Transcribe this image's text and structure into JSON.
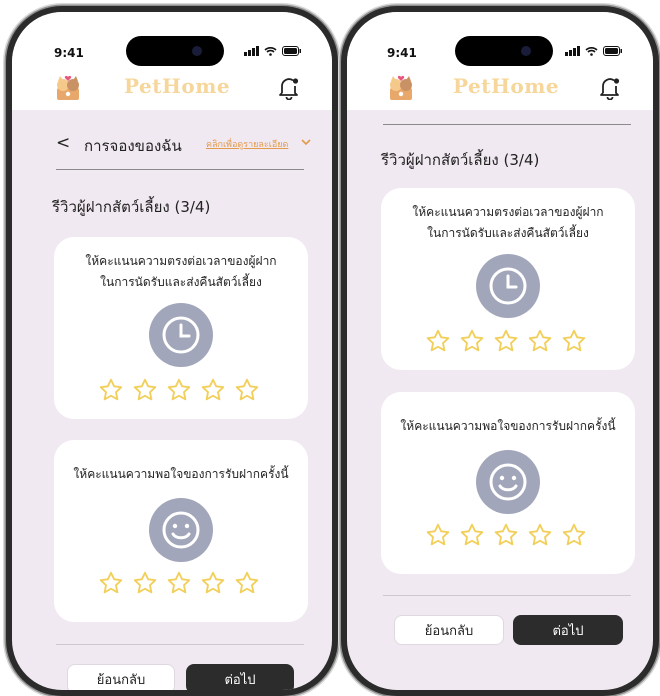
{
  "status": {
    "time": "9:41"
  },
  "brand": {
    "name": "PetHome"
  },
  "header": {
    "back_symbol": "<",
    "title": "การจองของฉัน",
    "details_link": "คลิกเพื่อดูรายละเอียด"
  },
  "section": {
    "title": "รีวิวผู้ฝากสัตว์เลี้ยง (3/4)"
  },
  "questions": [
    {
      "line1": "ให้คะแนนความตรงต่อเวลาของผู้ฝาก",
      "line2": "ในการนัดรับและส่งคืนสัตว์เลี้ยง",
      "icon": "clock-icon",
      "rating": 0,
      "max": 5
    },
    {
      "line1": "ให้คะแนนความพอใจของการรับฝากครั้งนี้",
      "line2": "",
      "icon": "smiley-icon",
      "rating": 0,
      "max": 5
    }
  ],
  "buttons": {
    "back": "ย้อนกลับ",
    "next": "ต่อไป"
  },
  "colors": {
    "background": "#f1e9f1",
    "brand": "#f6d69a",
    "accent": "#e29a4c",
    "icon_circle": "#a2a6ba",
    "star": "#f2cf5b",
    "button_dark": "#2c2c2c"
  }
}
